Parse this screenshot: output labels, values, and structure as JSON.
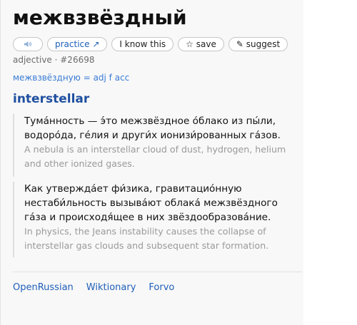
{
  "entry": {
    "headword": "межвзвёздный",
    "pos_meta": "adjective · #26698",
    "form_note": "межвзвёздную = adj f acc",
    "translation": "interstellar"
  },
  "buttons": {
    "audio_icon": "speaker-icon",
    "practice_label": "practice ↗",
    "know_label": "I know this",
    "save_label": "☆ save",
    "suggest_label": "✎ suggest"
  },
  "examples": [
    {
      "ru": "Тума́нность — э́то межзвёздное о́блако из пы́ли, водоро́да, ге́лия и други́х ионизи́рованных га́зов.",
      "en": "A nebula is an interstellar cloud of dust, hydrogen, helium and other ionized gases."
    },
    {
      "ru": "Как утвержда́ет фи́зика, гравитацио́нную нестаби́льность вызыва́ют облака́ межзвёздного га́за и происходя́щее в них звёздообразова́ние.",
      "en": "In physics, the Jeans instability causes the collapse of interstellar gas clouds and subsequent star formation."
    }
  ],
  "links": [
    "OpenRussian",
    "Wiktionary",
    "Forvo"
  ],
  "colors": {
    "accent_blue": "#1f5fb8",
    "form_blue": "#3a7bd5",
    "translation_blue": "#1f4fa0",
    "muted_text": "#9a9a9a"
  }
}
